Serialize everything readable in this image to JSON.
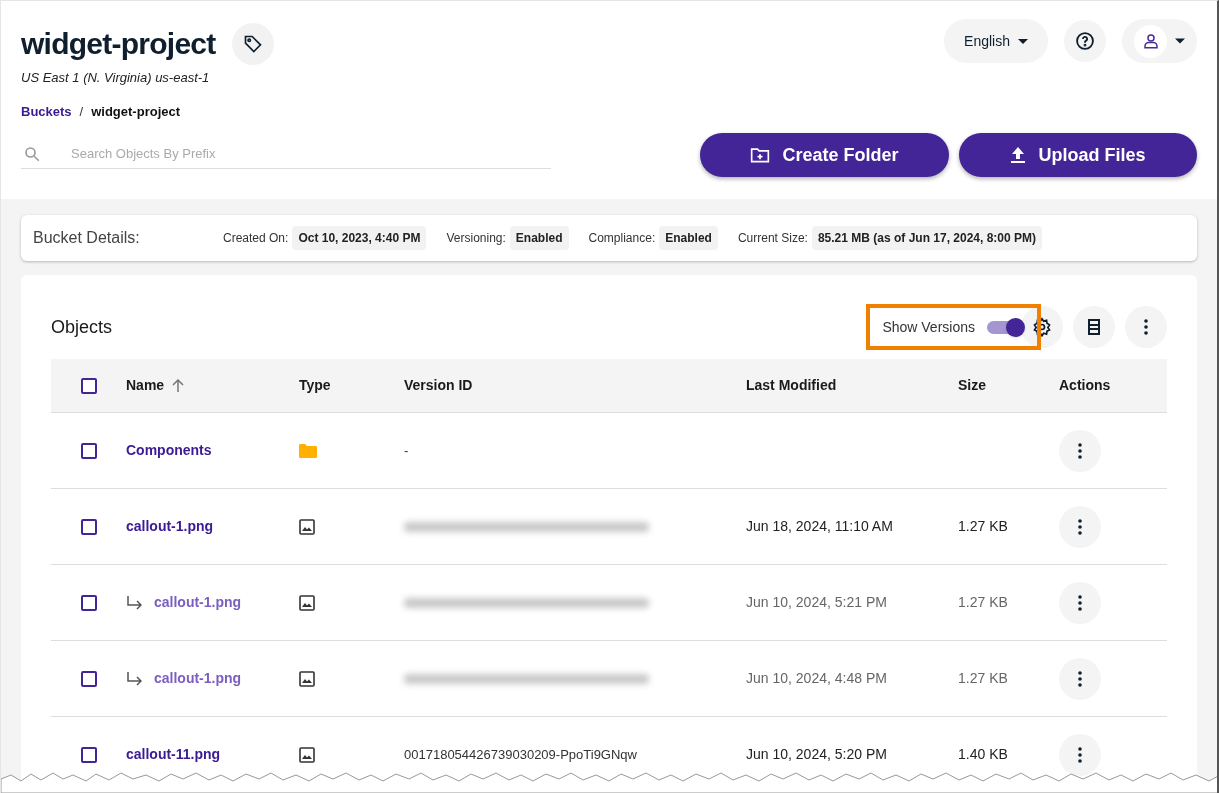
{
  "header": {
    "title": "widget-project",
    "region": "US East 1 (N. Virginia) us-east-1",
    "language": "English"
  },
  "breadcrumb": [
    {
      "label": "Buckets",
      "link": true
    },
    {
      "label": "widget-project",
      "link": false
    }
  ],
  "breadcrumb_separator": "/",
  "search": {
    "placeholder": "Search Objects By Prefix"
  },
  "actions": [
    "Create Folder",
    "Upload Files"
  ],
  "bucket_details": {
    "title": "Bucket Details:",
    "fields": [
      {
        "label": "Created On:",
        "value": "Oct 10, 2023, 4:40 PM"
      },
      {
        "label": "Versioning:",
        "value": "Enabled"
      },
      {
        "label": "Compliance:",
        "value": "Enabled"
      },
      {
        "label": "Current Size:",
        "value": "85.21 MB (as of Jun 17, 2024, 8:00 PM)"
      }
    ]
  },
  "objects": {
    "title": "Objects",
    "show_versions": {
      "label": "Show Versions",
      "on": true,
      "highlighted": true
    },
    "all_checked": false,
    "columns": [
      "Name",
      "Type",
      "Version ID",
      "Last Modified",
      "Size",
      "Actions"
    ],
    "rows": [
      {
        "name": "Components",
        "kind": "folder",
        "version": false,
        "version_id": "-",
        "checked": false
      },
      {
        "name": "callout-1.png",
        "kind": "image",
        "version": false,
        "version_blurred": true,
        "modified": "Jun 18, 2024, 11:10 AM",
        "size": "1.27 KB",
        "checked": false
      },
      {
        "name": "callout-1.png",
        "kind": "image",
        "version": true,
        "version_blurred": true,
        "modified": "Jun 10, 2024, 5:21 PM",
        "size": "1.27 KB",
        "checked": false
      },
      {
        "name": "callout-1.png",
        "kind": "image",
        "version": true,
        "version_blurred": true,
        "modified": "Jun 10, 2024, 4:48 PM",
        "size": "1.27 KB",
        "checked": false
      },
      {
        "name": "callout-11.png",
        "kind": "image",
        "version": false,
        "version_id": "001718054426739030209-PpoTi9GNqw",
        "modified": "Jun 10, 2024, 5:20 PM",
        "size": "1.40 KB",
        "checked": false
      }
    ]
  }
}
